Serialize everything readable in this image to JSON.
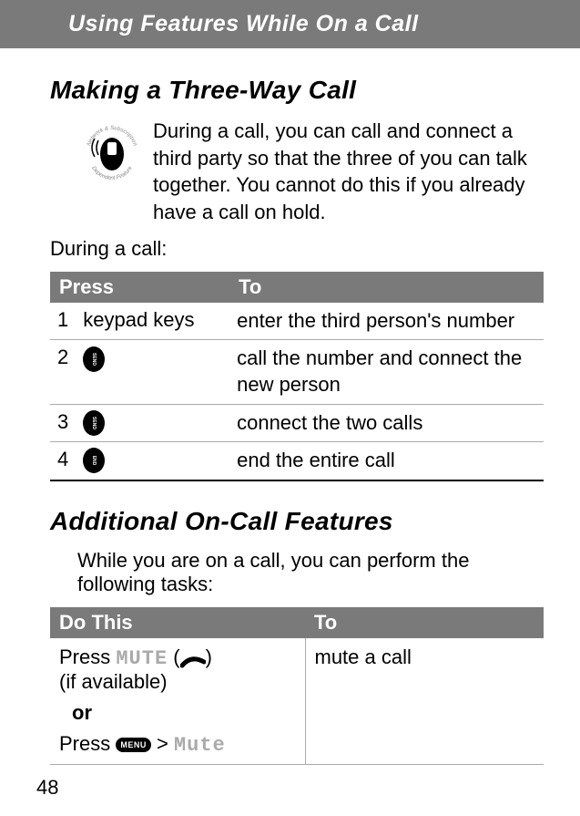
{
  "header": "Using Features While On a Call",
  "page_number": "48",
  "section1": {
    "title": "Making a Three-Way Call",
    "intro": "During a call, you can call and connect a third party so that the three of you can talk together. You cannot do this if you already have a call on hold.",
    "lead": "During a call:",
    "icon_caption_top": "Network & Subscription",
    "icon_caption_bottom": "Dependent Feature",
    "columns": {
      "press": "Press",
      "to": "To"
    },
    "rows": [
      {
        "num": "1",
        "press_text": "keypad keys",
        "press_icon": null,
        "to": "enter the third person's number"
      },
      {
        "num": "2",
        "press_text": "",
        "press_icon": "send",
        "to": "call the number and connect the new person"
      },
      {
        "num": "3",
        "press_text": "",
        "press_icon": "send",
        "to": "connect the two calls"
      },
      {
        "num": "4",
        "press_text": "",
        "press_icon": "end",
        "to": "end the entire call"
      }
    ]
  },
  "section2": {
    "title": "Additional On-Call Features",
    "lead": "While you are on a call, you can perform the following tasks:",
    "columns": {
      "dothis": "Do This",
      "to": "To"
    },
    "row1": {
      "press_word": "Press ",
      "mute_label": "MUTE",
      "paren_open": " (",
      "paren_close": ")",
      "if_available": "(if available)",
      "or": "or",
      "press_word2": "Press ",
      "gt": " > ",
      "mute_label2": "Mute",
      "to": "mute a call"
    }
  }
}
